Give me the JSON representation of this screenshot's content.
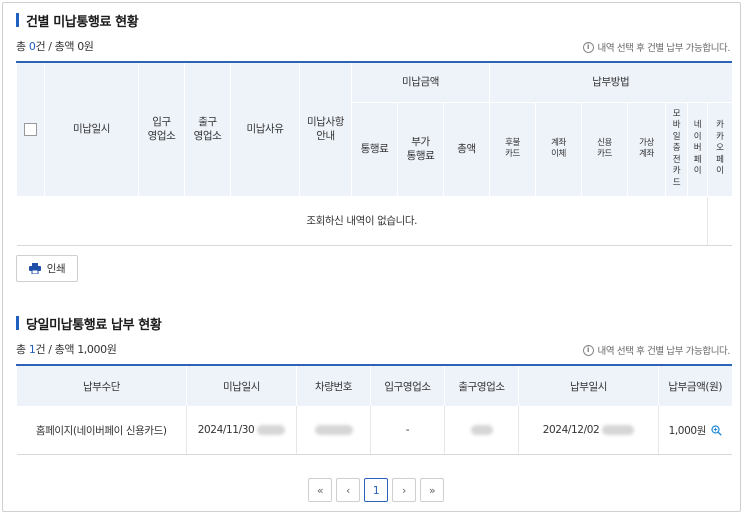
{
  "section1": {
    "title": "건별 미납통행료 현황",
    "summary_prefix": "총 ",
    "count": "0",
    "summary_mid": "건 / 총액 ",
    "amount": "0원",
    "notice": "내역 선택 후 건별 납부 가능합니다.",
    "headers": {
      "unpaid_date": "미납일시",
      "entry_office": "입구\n영업소",
      "exit_office": "출구\n영업소",
      "unpaid_reason": "미납사유",
      "unpaid_guide": "미납사항\n안내",
      "unpaid_amount_group": "미납금액",
      "toll": "통행료",
      "surcharge": "부가\n통행료",
      "total": "총액",
      "payment_method_group": "납부방법",
      "postpaid_card": "후불\n카드",
      "bank_transfer": "계좌\n이체",
      "credit_card": "신용\n카드",
      "virtual_account": "가상\n계좌",
      "mobile_charge_card": "모\n바\n일\n충\n전\n카\n드",
      "naver_pay": "네\n이\n버\n페\n이",
      "kakao_pay": "카\n카\n오\n페\n이"
    },
    "empty_message": "조회하신 내역이 없습니다.",
    "print_label": "인쇄"
  },
  "section2": {
    "title": "당일미납통행료 납부 현황",
    "summary_prefix": "총 ",
    "count": "1",
    "summary_mid": "건 / 총액 ",
    "amount": "1,000원",
    "notice": "내역 선택 후 건별 납부 가능합니다.",
    "headers": [
      "납부수단",
      "미납일시",
      "차량번호",
      "입구영업소",
      "출구영업소",
      "납부일시",
      "납부금액(원)"
    ],
    "row": {
      "payment_method": "홈페이지(네이버페이 신용카드)",
      "unpaid_date": "2024/11/30",
      "entry_office": "-",
      "payment_date": "2024/12/02",
      "amount": "1,000원"
    }
  },
  "pagination": {
    "first": "«",
    "prev": "‹",
    "current": "1",
    "next": "›",
    "last": "»"
  },
  "colors": {
    "accent": "#2b63b8",
    "header_bg": "#eef3fa"
  }
}
